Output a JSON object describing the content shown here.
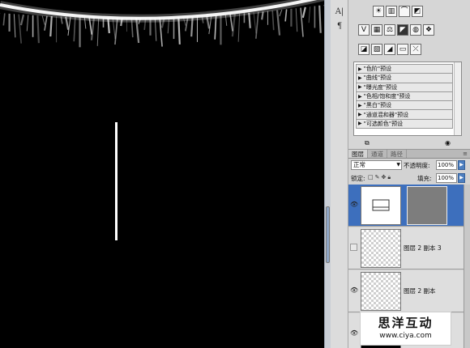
{
  "strip": {
    "char_button": "A|",
    "paragraph_button": "¶"
  },
  "adjustments": {
    "presets": [
      "\"色阶\"预设",
      "\"曲线\"预设",
      "\"曝光度\"预设",
      "\"色相/饱和度\"预设",
      "\"黑白\"预设",
      "\"通道混和器\"预设",
      "\"可选颜色\"预设"
    ]
  },
  "layers_panel": {
    "tabs": [
      "图层",
      "通道",
      "路径"
    ],
    "active_tab": "图层",
    "close_glyph": "≡",
    "blend_mode": "正常",
    "opacity_label": "不透明度:",
    "opacity_value": "100%",
    "lock_label": "锁定:",
    "fill_label": "填充:",
    "fill_value": "100%",
    "layers": [
      {
        "name": "",
        "visible": true,
        "selected": true,
        "has_mask": true
      },
      {
        "name": "图层 2 副本 3",
        "visible": false,
        "selected": false
      },
      {
        "name": "图层 2 副本",
        "visible": true,
        "selected": false
      },
      {
        "name": "",
        "visible": true,
        "selected": false
      }
    ]
  },
  "watermark": {
    "title": "思洋互动",
    "url": "www.ciya.com"
  },
  "colors": {
    "selection": "#3d6fbd",
    "canvas": "#000000",
    "accent_button": "#4d7fc0"
  }
}
